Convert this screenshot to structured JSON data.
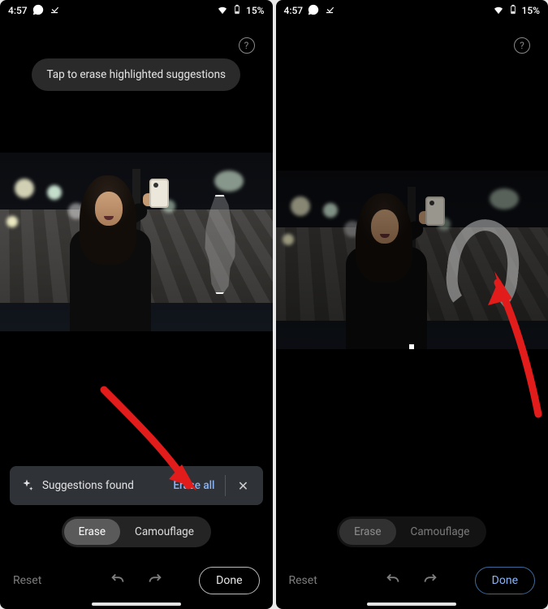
{
  "status": {
    "time": "4:57",
    "battery_text": "15%"
  },
  "screen_left": {
    "tooltip": "Tap to erase highlighted suggestions",
    "suggestions": {
      "label": "Suggestions found",
      "action": "Erase all"
    },
    "modes": {
      "erase": "Erase",
      "camouflage": "Camouflage"
    },
    "bottom": {
      "reset": "Reset",
      "done": "Done"
    }
  },
  "screen_right": {
    "modes": {
      "erase": "Erase",
      "camouflage": "Camouflage"
    },
    "bottom": {
      "reset": "Reset",
      "done": "Done"
    }
  }
}
